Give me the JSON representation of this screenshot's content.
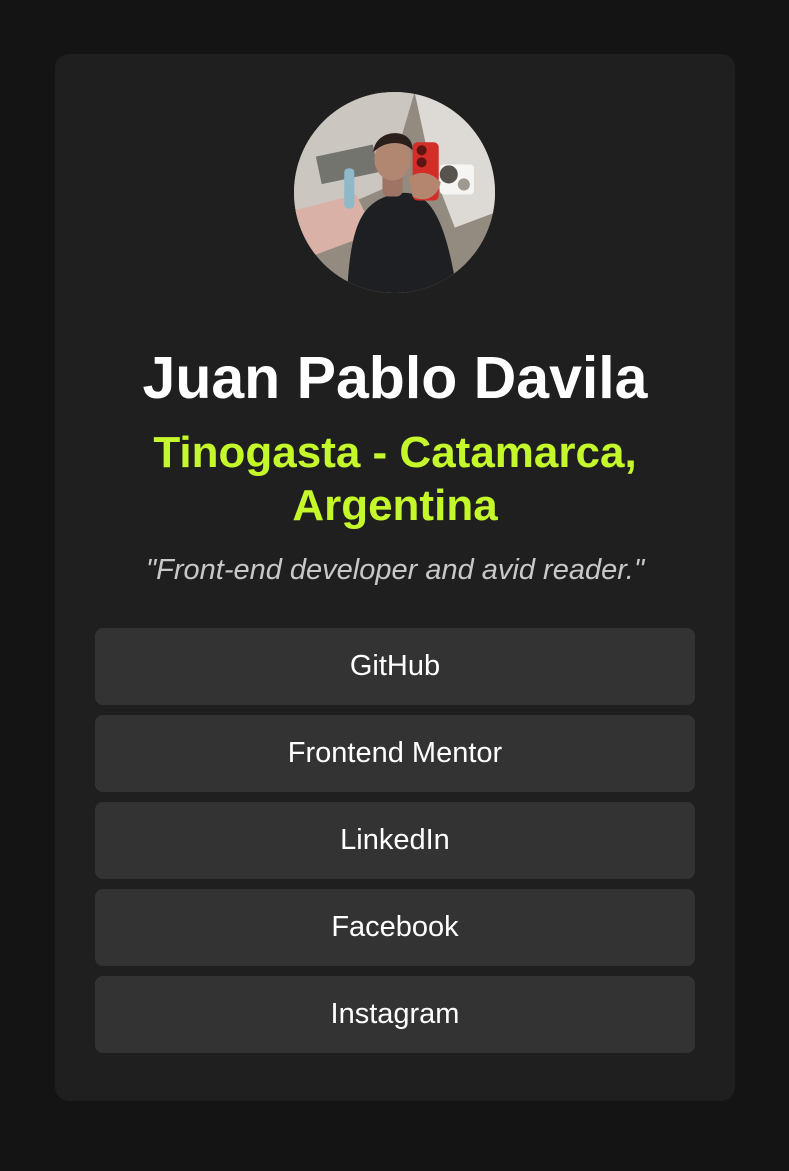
{
  "profile": {
    "avatar_icon": "profile-photo-avatar",
    "name": "Juan Pablo Davila",
    "location": "Tinogasta - Catamarca, Argentina",
    "bio": "\"Front-end developer and avid reader.\""
  },
  "links": [
    {
      "label": "GitHub"
    },
    {
      "label": "Frontend Mentor"
    },
    {
      "label": "LinkedIn"
    },
    {
      "label": "Facebook"
    },
    {
      "label": "Instagram"
    }
  ],
  "colors": {
    "page_background": "#141414",
    "card_background": "#1f1f1f",
    "button_background": "#333333",
    "accent": "#c4f82a",
    "name_text": "#ffffff",
    "bio_text": "#c8c8c8"
  }
}
